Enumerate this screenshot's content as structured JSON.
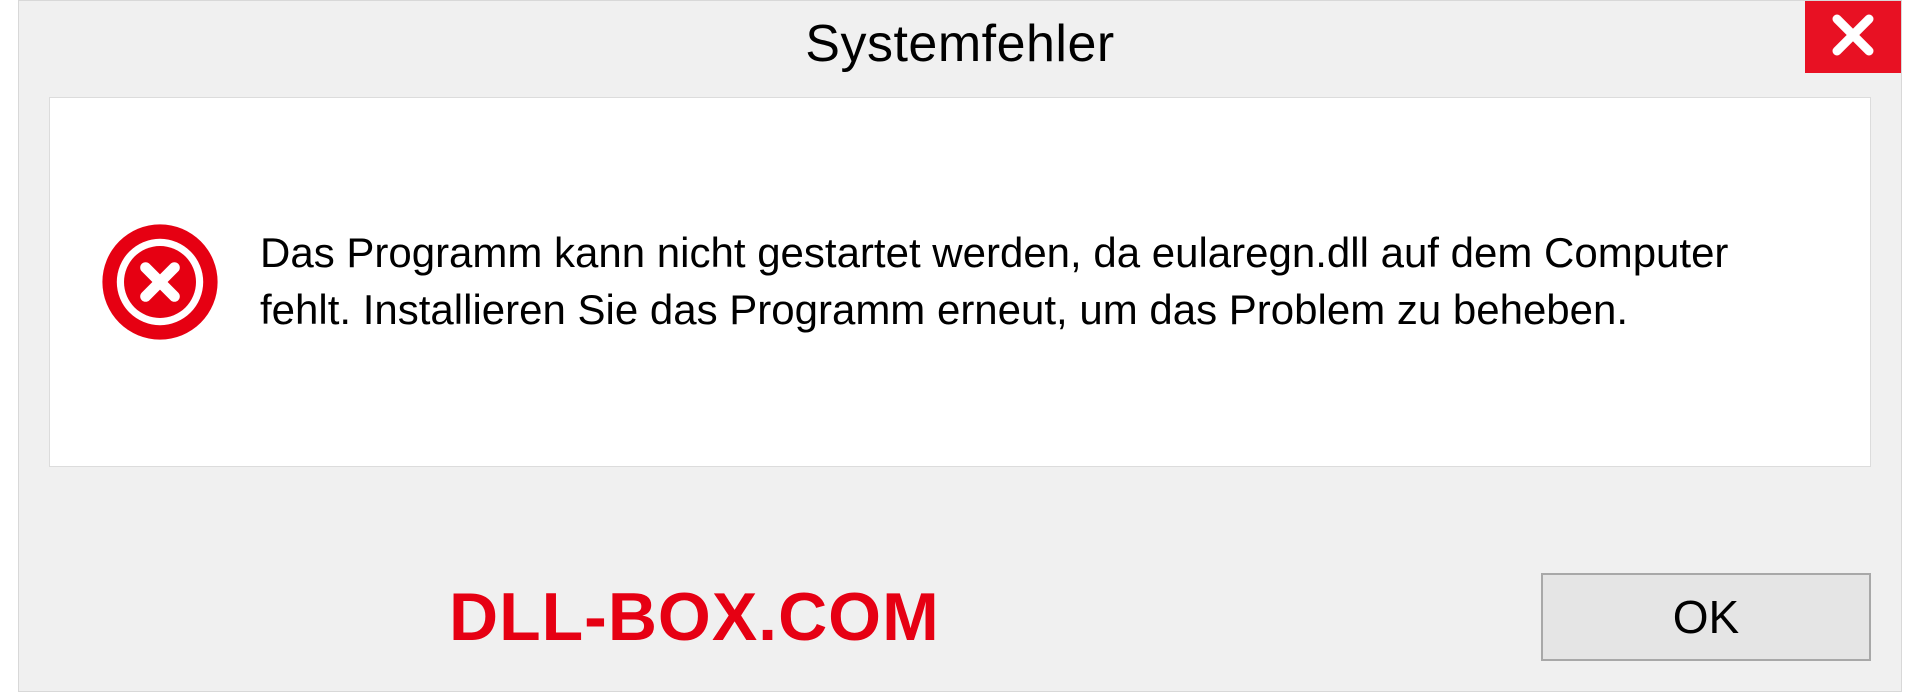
{
  "dialog": {
    "title": "Systemfehler",
    "message": "Das Programm kann nicht gestartet werden, da eularegn.dll auf dem Computer fehlt. Installieren Sie das Programm erneut, um das Problem zu beheben.",
    "ok_label": "OK"
  },
  "watermark": "DLL-BOX.COM"
}
